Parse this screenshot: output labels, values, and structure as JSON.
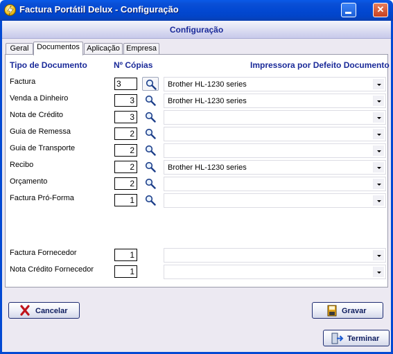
{
  "window": {
    "title": "Factura Portátil Delux - Configuração",
    "minimize_icon": "minimize-icon",
    "close_icon": "close-icon",
    "close_glyph": "✕"
  },
  "header": {
    "title": "Configuração"
  },
  "tabs": [
    {
      "label": "Geral",
      "active": false
    },
    {
      "label": "Documentos",
      "active": true
    },
    {
      "label": "Aplicação",
      "active": false
    },
    {
      "label": "Empresa",
      "active": false
    }
  ],
  "columns": {
    "doc_type": "Tipo de Documento",
    "copies": "Nº Cópias",
    "printer": "Impressora por Defeito Documento"
  },
  "documents": [
    {
      "label": "Factura",
      "copies": "3",
      "printer": "Brother HL-1230 series"
    },
    {
      "label": "Venda a Dinheiro",
      "copies": "3",
      "printer": "Brother HL-1230 series"
    },
    {
      "label": "Nota de Crédito",
      "copies": "3",
      "printer": ""
    },
    {
      "label": "Guia de Remessa",
      "copies": "2",
      "printer": ""
    },
    {
      "label": "Guia de Transporte",
      "copies": "2",
      "printer": ""
    },
    {
      "label": "Recibo",
      "copies": "2",
      "printer": "Brother HL-1230 series"
    },
    {
      "label": "Orçamento",
      "copies": "2",
      "printer": ""
    },
    {
      "label": "Factura Pró-Forma",
      "copies": "1",
      "printer": ""
    }
  ],
  "supplier_documents": [
    {
      "label": "Factura Fornecedor",
      "copies": "1",
      "printer": ""
    },
    {
      "label": "Nota Crédito Fornecedor",
      "copies": "1",
      "printer": ""
    }
  ],
  "buttons": {
    "cancel": "Cancelar",
    "save": "Gravar",
    "finish": "Terminar"
  },
  "colors": {
    "title_bar": "#0349d3",
    "heading_text": "#1a2a99",
    "cancel_icon": "#c0141c"
  }
}
